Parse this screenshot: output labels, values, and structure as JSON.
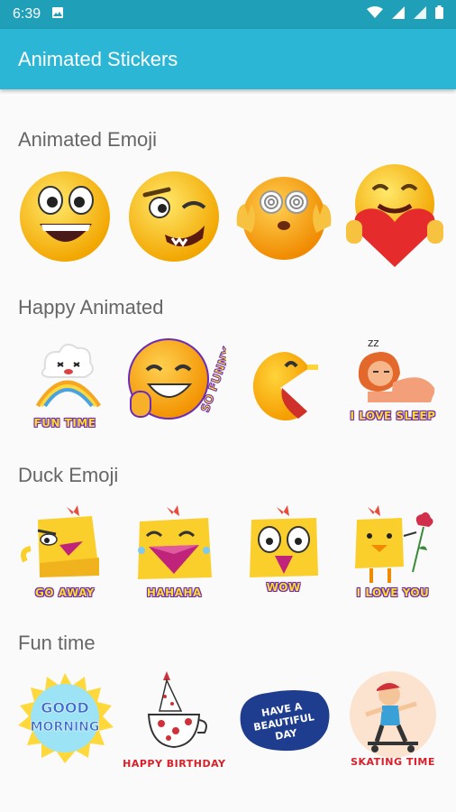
{
  "status_bar": {
    "time": "6:39"
  },
  "app_bar": {
    "title": "Animated Stickers"
  },
  "sections": [
    {
      "title": "Animated Emoji"
    },
    {
      "title": "Happy Animated",
      "captions": [
        "FUN TIME",
        "SO FUNNY",
        "",
        "I LOVE SLEEP"
      ]
    },
    {
      "title": "Duck Emoji",
      "captions": [
        "GO AWAY",
        "HAHAHA",
        "WOW",
        "I LOVE YOU"
      ]
    },
    {
      "title": "Fun time",
      "captions": [
        "GOOD MORNING",
        "HAPPY BIRTHDAY",
        "HAVE A BEAUTIFUL DAY",
        "SKATING TIME"
      ]
    }
  ],
  "colors": {
    "status": "#1f9fb8",
    "appbar": "#2bb6d6",
    "background": "#fafafa"
  }
}
